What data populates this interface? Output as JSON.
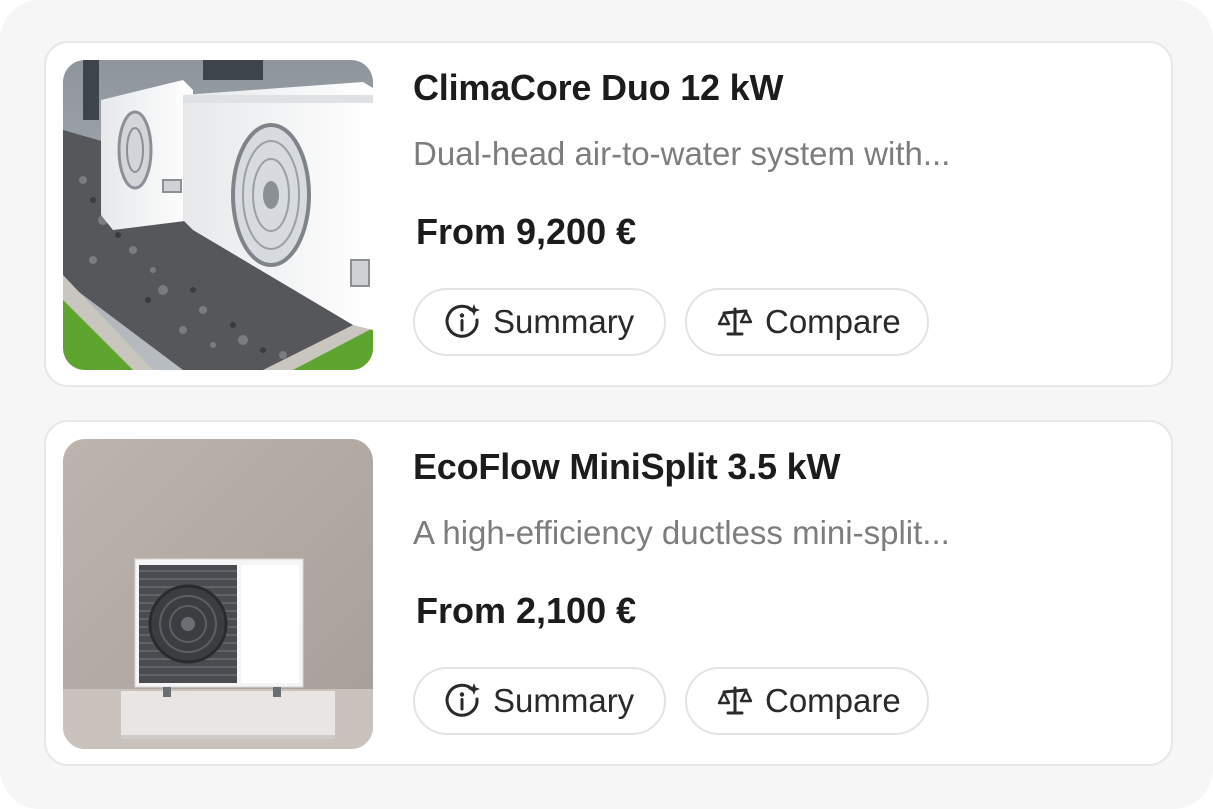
{
  "products": [
    {
      "title": "ClimaCore Duo 12 kW",
      "description": "Dual-head air-to-water system with...",
      "price": "From 9,200 €",
      "image_icon": "outdoor-heat-pump-units-photo",
      "summary_label": "Summary",
      "compare_label": "Compare"
    },
    {
      "title": "EcoFlow MiniSplit 3.5 kW",
      "description": "A high-efficiency ductless mini-split...",
      "price": "From 2,100 €",
      "image_icon": "mini-split-unit-photo",
      "summary_label": "Summary",
      "compare_label": "Compare"
    }
  ],
  "icons": {
    "summary": "info-sparkle-icon",
    "compare": "scale-icon"
  },
  "colors": {
    "panel_bg": "#f6f6f6",
    "card_border": "#e7e7e7",
    "title": "#1c1c1c",
    "description": "#7d7d7d"
  }
}
